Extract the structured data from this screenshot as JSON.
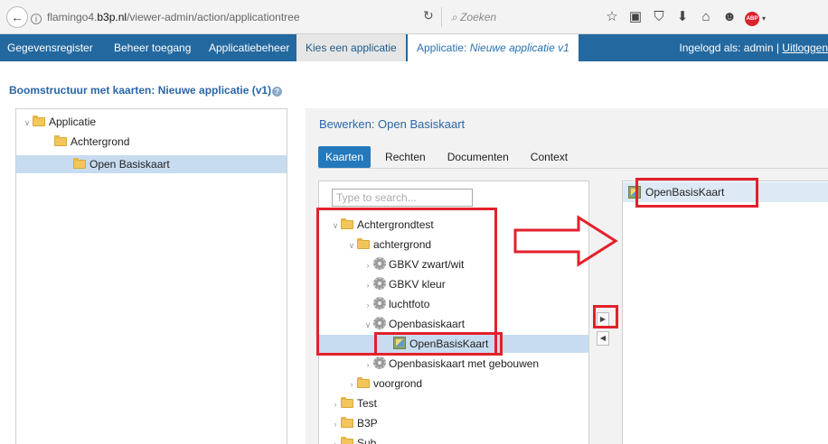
{
  "browser": {
    "url_prefix": "flamingo4.",
    "url_host": "b3p.nl",
    "url_path": "/viewer-admin/action/applicationtree",
    "search_placeholder": "Zoeken",
    "back_glyph": "←",
    "info_glyph": "i",
    "reload_glyph": "↻",
    "search_glyph": "⌕",
    "toolbar_icons": [
      "star-icon",
      "reading-list-icon",
      "pocket-icon",
      "download-icon",
      "home-icon",
      "chat-icon",
      "adblock-icon"
    ],
    "toolbar_glyphs": {
      "star": "☆",
      "reading": "▣",
      "pocket": "⛉",
      "download": "⬇",
      "home": "⌂",
      "chat": "☻"
    },
    "abp_label": "ABP",
    "abp_caret": "▾"
  },
  "nav": {
    "items": [
      "Gegevensregister",
      "Beheer toegang",
      "Applicatiebeheer"
    ],
    "active": "Kies een applicatie",
    "app_label": "Applicatie:",
    "app_name": "Nieuwe applicatie v1",
    "login_label": "Ingelogd als: admin |",
    "logout_label": "Uitloggen"
  },
  "page": {
    "title": "Boomstructuur met kaarten: Nieuwe applicatie (v1)",
    "help_glyph": "?"
  },
  "left_tree": {
    "items": [
      {
        "label": "Applicatie",
        "level": 0,
        "expanded": true
      },
      {
        "label": "Achtergrond",
        "level": 1,
        "expanded": true
      },
      {
        "label": "Open Basiskaart",
        "level": 2,
        "selected": true
      }
    ]
  },
  "editor": {
    "title": "Bewerken: Open Basiskaart",
    "tabs": [
      "Kaarten",
      "Rechten",
      "Documenten",
      "Context"
    ],
    "active_tab": "Kaarten",
    "search_placeholder": "Type to search...",
    "tree": [
      {
        "label": "Achtergrondtest",
        "level": 0,
        "icon": "folder",
        "expanded": true
      },
      {
        "label": "achtergrond",
        "level": 1,
        "icon": "folder",
        "expanded": true
      },
      {
        "label": "GBKV zwart/wit",
        "level": 2,
        "icon": "gear",
        "expanded": false
      },
      {
        "label": "GBKV kleur",
        "level": 2,
        "icon": "gear",
        "expanded": false
      },
      {
        "label": "luchtfoto",
        "level": 2,
        "icon": "gear",
        "expanded": false
      },
      {
        "label": "Openbasiskaart",
        "level": 2,
        "icon": "gear",
        "expanded": true
      },
      {
        "label": "OpenBasisKaart",
        "level": 3,
        "icon": "layer",
        "selected": true
      },
      {
        "label": "Openbasiskaart met gebouwen",
        "level": 2,
        "icon": "gear",
        "expanded": false
      },
      {
        "label": "voorgrond",
        "level": 1,
        "icon": "folder",
        "expanded": false
      },
      {
        "label": "Test",
        "level": 0,
        "icon": "folder",
        "expanded": false
      },
      {
        "label": "B3P",
        "level": 0,
        "icon": "folder",
        "expanded": false
      },
      {
        "label": "Sub...",
        "level": 0,
        "icon": "folder",
        "expanded": false
      }
    ],
    "move_right_glyph": "▶",
    "move_left_glyph": "◀",
    "selected_layers": [
      "OpenBasisKaart"
    ]
  },
  "colors": {
    "nav_bg": "#23689f",
    "accent_blue": "#2479bd",
    "annotation_red": "#e3212b",
    "selection_blue": "#c7dcf0"
  }
}
